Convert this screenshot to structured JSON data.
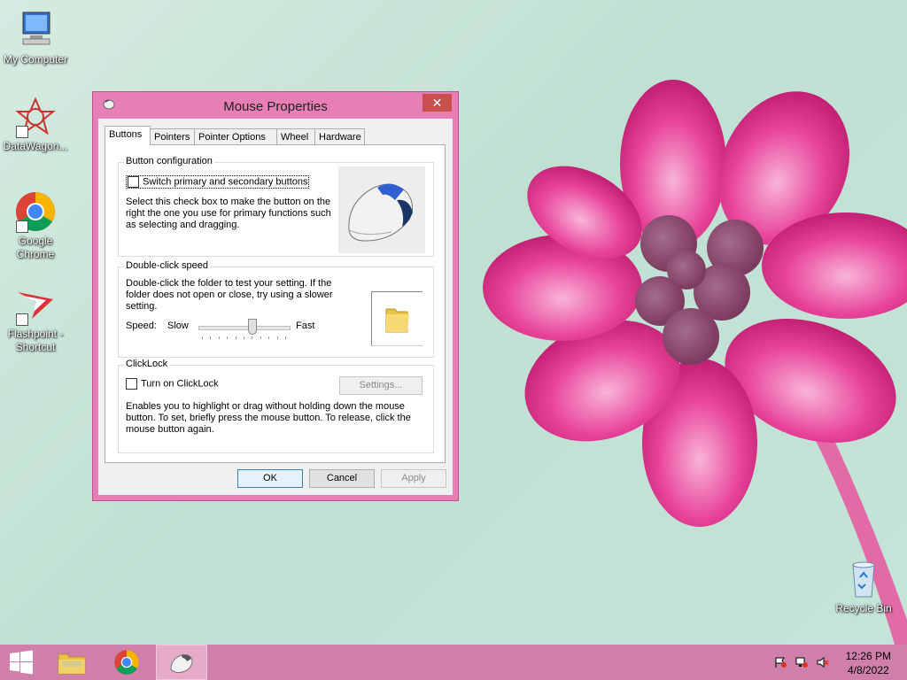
{
  "desktop": {
    "icons": [
      {
        "label": "My Computer",
        "icon": "computer-icon"
      },
      {
        "label": "DataWagon...",
        "icon": "datawagon-icon"
      },
      {
        "label": "Google Chrome",
        "icon": "chrome-icon"
      },
      {
        "label": "Flashpoint - Shortcut",
        "icon": "flashpoint-icon"
      },
      {
        "label": "Recycle Bin",
        "icon": "recycle-bin-icon"
      }
    ]
  },
  "window": {
    "title": "Mouse Properties",
    "close_glyph": "✕",
    "tabs": [
      "Buttons",
      "Pointers",
      "Pointer Options",
      "Wheel",
      "Hardware"
    ],
    "active_tab": "Buttons",
    "button_config": {
      "title": "Button configuration",
      "checkbox_label": "Switch primary and secondary buttons",
      "checked": false,
      "description": "Select this check box to make the button on the right the one you use for primary functions such as selecting and dragging."
    },
    "double_click": {
      "title": "Double-click speed",
      "description": "Double-click the folder to test your setting. If the folder does not open or close, try using a slower setting.",
      "speed_label": "Speed:",
      "slow_label": "Slow",
      "fast_label": "Fast",
      "slider_value": 0.6
    },
    "clicklock": {
      "title": "ClickLock",
      "checkbox_label": "Turn on ClickLock",
      "checked": false,
      "settings_label": "Settings...",
      "description": "Enables you to highlight or drag without holding down the mouse button. To set, briefly press the mouse button. To release, click the mouse button again."
    },
    "buttons": {
      "ok": "OK",
      "cancel": "Cancel",
      "apply": "Apply"
    }
  },
  "taskbar": {
    "clock_time": "12:26 PM",
    "clock_date": "4/8/2022",
    "items": [
      "start-icon",
      "file-explorer-icon",
      "chrome-icon",
      "mouse-properties-icon"
    ],
    "tray": [
      "action-center-flag-icon",
      "network-icon",
      "volume-muted-icon"
    ]
  },
  "colors": {
    "window_frame": "#e57fb5",
    "taskbar": "#cf7faa",
    "close_button": "#c7504f"
  }
}
